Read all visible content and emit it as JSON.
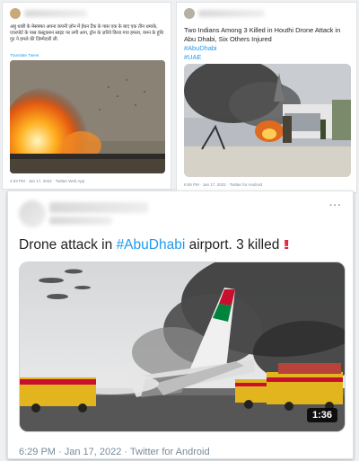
{
  "tweet_left": {
    "text": "अबु धाबी के मेसफ्फा अपना कंपनी ज़ोन में ईंधन टैंक के पास एक के बाद एक तीन धमाके, एयरपोर्ट के पास कंस्ट्रक्शन साइट पर लगी आग, ड्रोन के ज़रिये किया गया हमला, यमन के हूथि गुट ने हमले की ज़िम्मेदारी ली.",
    "translate": "Translate Tweet",
    "meta": "4:03 PM · Jan 17, 2022 · Twitter Web App",
    "image_icon": "explosion-photo"
  },
  "tweet_right": {
    "text": "Two Indians Among 3 Killed in Houthi Drone Attack in Abu Dhabi, Six Others Injured",
    "hashtags": [
      "#AbuDhabi",
      "#UAE"
    ],
    "meta": "6:59 PM · Jan 17, 2022 · Twitter for Android",
    "image_icon": "burning-truck-photo"
  },
  "tweet_main": {
    "text_before": "Drone attack in ",
    "hashtag": "#AbuDhabi",
    "text_after": " airport. 3 killed",
    "emoji": "‼️",
    "more": "···",
    "video_duration": "1:36",
    "meta": "6:29 PM · Jan 17, 2022 · Twitter for Android",
    "image_icon": "burning-airplane-video"
  },
  "colors": {
    "link": "#1d9bf0",
    "emoji_red": "#e0263c",
    "emirates_red": "#c8102e",
    "emirates_green": "#00843d"
  }
}
